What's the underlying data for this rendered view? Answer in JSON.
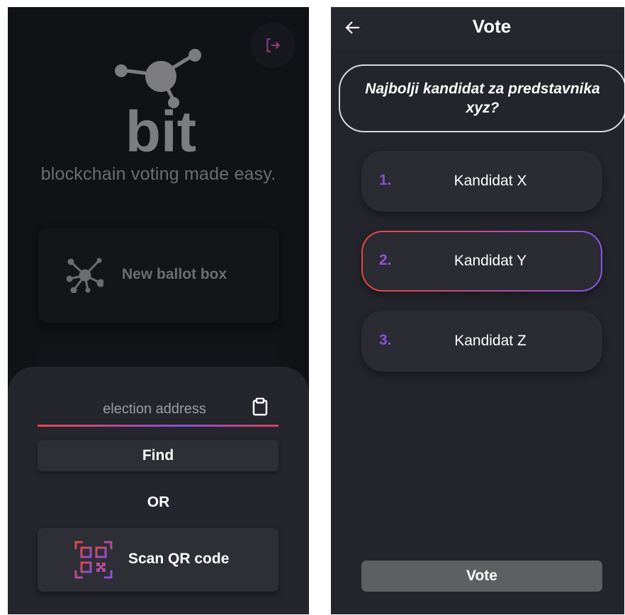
{
  "left_screen": {
    "logo": {
      "text": "bit"
    },
    "tagline": "blockchain voting made easy.",
    "new_ballot": {
      "label": "New ballot box",
      "icon": "network-nodes-icon"
    },
    "bottom_sheet": {
      "address_input": {
        "value": "",
        "placeholder": "election address"
      },
      "paste_icon": "clipboard-icon",
      "find_label": "Find",
      "or_label": "OR",
      "scan_label": "Scan QR code",
      "scan_icon": "qr-code-icon"
    },
    "logout_icon": "logout-icon",
    "colors": {
      "background": "#111216",
      "sheet": "#24252d",
      "accent_red": "#e94848",
      "accent_purple": "#8a4fd8"
    }
  },
  "right_screen": {
    "title": "Vote",
    "back_icon": "arrow-left-icon",
    "question": "Najbolji kandidat za predstavnika xyz?",
    "candidates": [
      {
        "number": "1.",
        "name": "Kandidat X",
        "selected": false,
        "number_color": "#8a4fd8"
      },
      {
        "number": "2.",
        "name": "Kandidat Y",
        "selected": true,
        "number_color": "#9a52d6"
      },
      {
        "number": "3.",
        "name": "Kandidat Z",
        "selected": false,
        "number_color": "#8a4fd8"
      }
    ],
    "vote_label": "Vote",
    "colors": {
      "background": "#23242c",
      "selected_border_start": "#e7463e",
      "selected_border_end": "#8b55e6"
    }
  }
}
